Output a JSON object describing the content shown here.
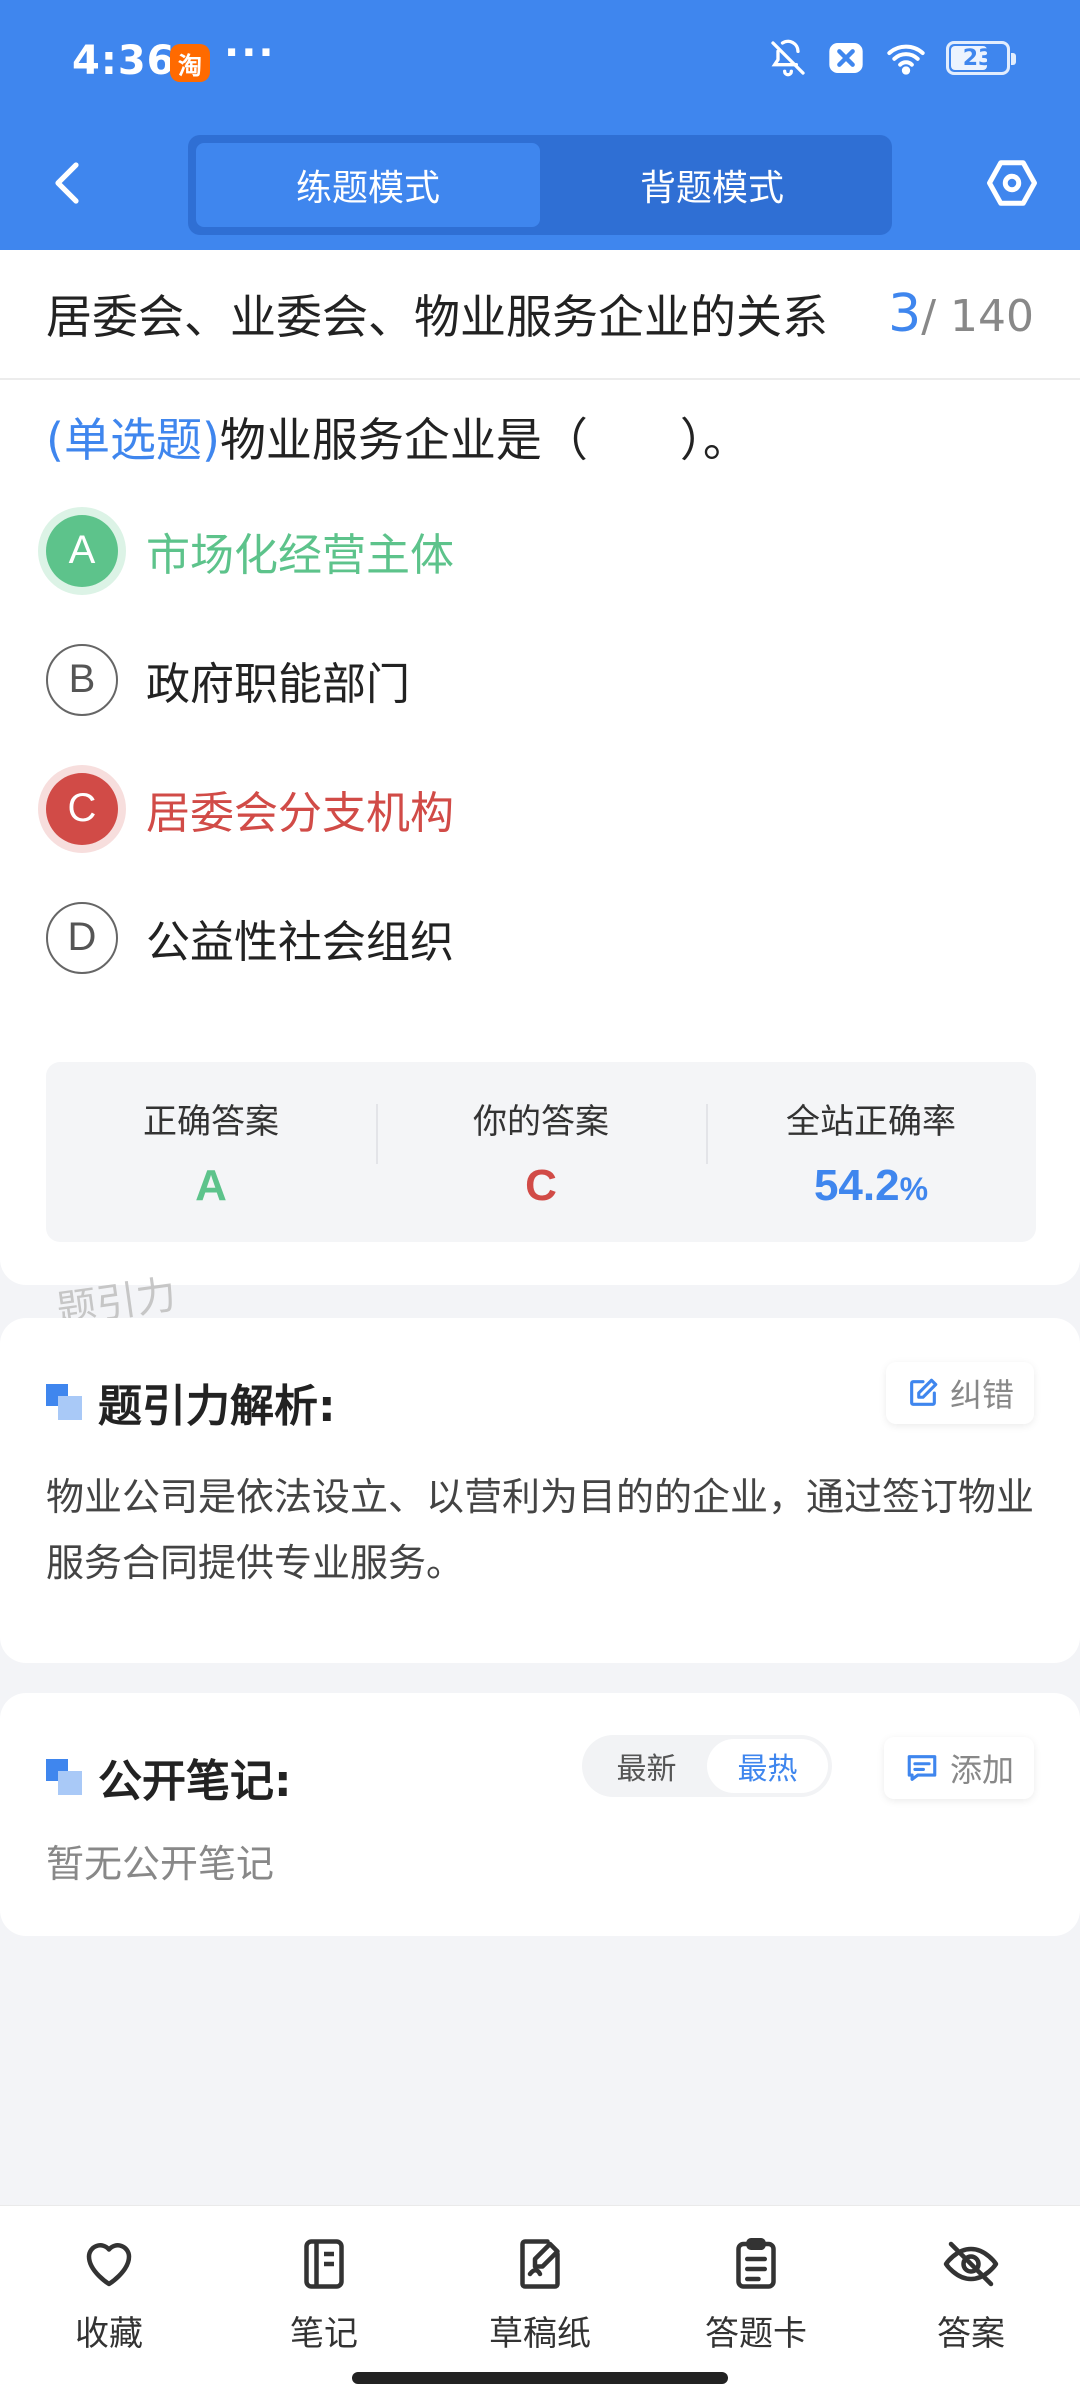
{
  "status_bar": {
    "time": "4:36",
    "app_icon_text": "淘",
    "dots": "···",
    "battery": "23"
  },
  "nav": {
    "mode_tabs": [
      "练题模式",
      "背题模式"
    ],
    "active_tab": 0
  },
  "question_header": {
    "title": "居委会、业委会、物业服务企业的关系",
    "current": "3",
    "total": "/ 140"
  },
  "question": {
    "type": "(单选题)",
    "text": "物业服务企业是（　　）。",
    "options": [
      {
        "letter": "A",
        "text": "市场化经营主体",
        "state": "correct"
      },
      {
        "letter": "B",
        "text": "政府职能部门",
        "state": "normal"
      },
      {
        "letter": "C",
        "text": "居委会分支机构",
        "state": "wrong"
      },
      {
        "letter": "D",
        "text": "公益性社会组织",
        "state": "normal"
      }
    ]
  },
  "answer_summary": {
    "correct_label": "正确答案",
    "correct_value": "A",
    "yours_label": "你的答案",
    "yours_value": "C",
    "rate_label": "全站正确率",
    "rate_value": "54.2",
    "rate_unit": "%"
  },
  "watermark": "题引力",
  "analysis": {
    "title": "题引力解析:",
    "report_label": "纠错",
    "text": "物业公司是依法设立、以营利为目的的企业，通过签订物业服务合同提供专业服务。"
  },
  "notes": {
    "title": "公开笔记:",
    "sort_options": [
      "最新",
      "最热"
    ],
    "active_sort": 1,
    "add_label": "添加",
    "empty_text": "暂无公开笔记"
  },
  "bottom_bar": {
    "items": [
      {
        "label": "收藏",
        "icon": "heart-icon"
      },
      {
        "label": "笔记",
        "icon": "notebook-icon"
      },
      {
        "label": "草稿纸",
        "icon": "draft-paper-icon"
      },
      {
        "label": "答题卡",
        "icon": "answer-sheet-icon"
      },
      {
        "label": "答案",
        "icon": "eye-off-icon"
      }
    ]
  },
  "colors": {
    "primary": "#3F86EE",
    "correct": "#5DC38B",
    "wrong": "#D14B47"
  }
}
